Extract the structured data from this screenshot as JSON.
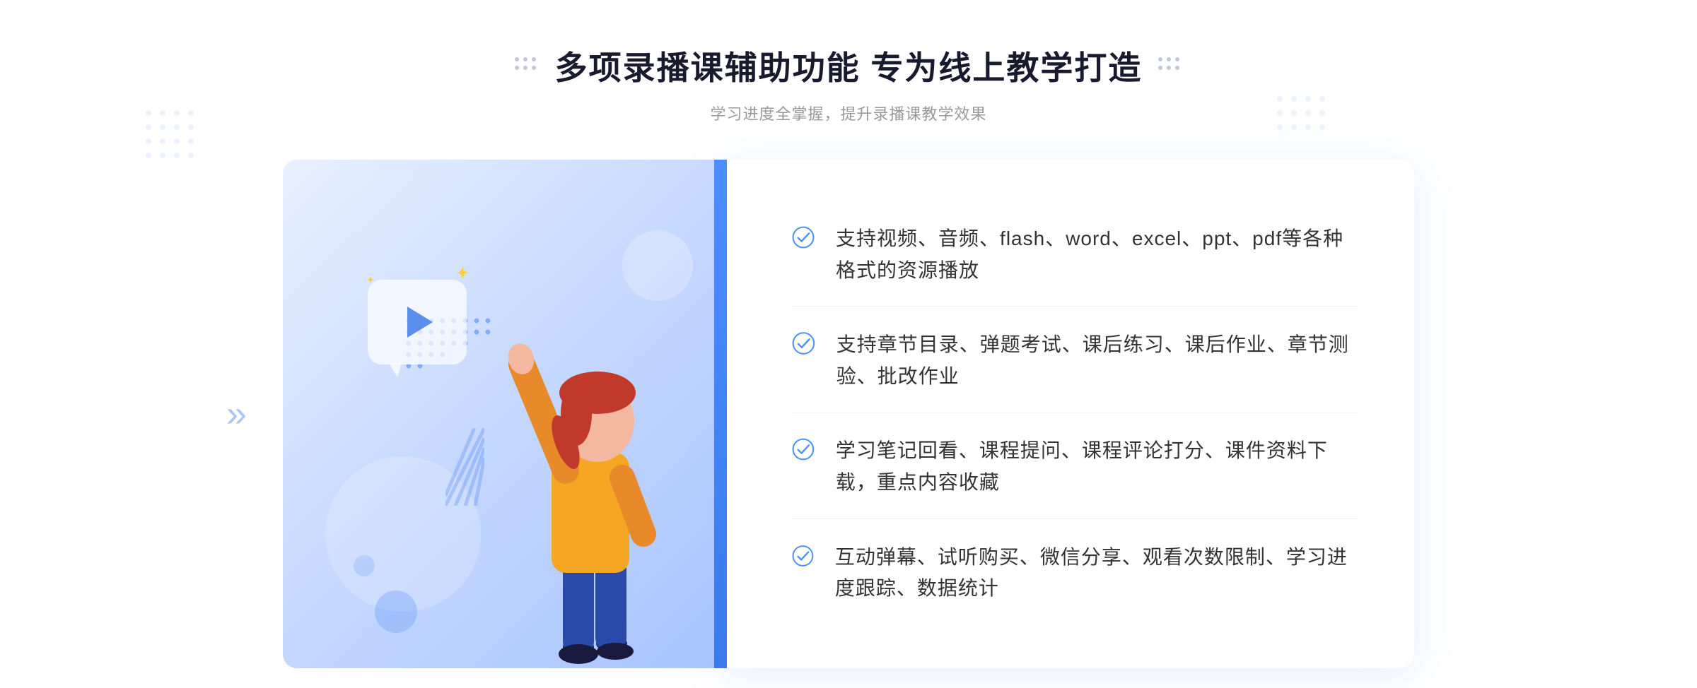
{
  "page": {
    "background_color": "#ffffff"
  },
  "header": {
    "title": "多项录播课辅助功能 专为线上教学打造",
    "subtitle": "学习进度全掌握，提升录播课教学效果"
  },
  "features": [
    {
      "id": 1,
      "text": "支持视频、音频、flash、word、excel、ppt、pdf等各种格式的资源播放"
    },
    {
      "id": 2,
      "text": "支持章节目录、弹题考试、课后练习、课后作业、章节测验、批改作业"
    },
    {
      "id": 3,
      "text": "学习笔记回看、课程提问、课程评论打分、课件资料下载，重点内容收藏"
    },
    {
      "id": 4,
      "text": "互动弹幕、试听购买、微信分享、观看次数限制、学习进度跟踪、数据统计"
    }
  ],
  "colors": {
    "primary_blue": "#4a90ff",
    "title_color": "#1a1a2e",
    "text_color": "#333333",
    "subtitle_color": "#999999",
    "check_color": "#4a90ff",
    "bg_gradient_start": "#e8f0ff",
    "bg_gradient_end": "#a8c4ff"
  },
  "icons": {
    "play": "▶",
    "check": "✓",
    "chevron_left": "《",
    "chevron_right": "》"
  }
}
